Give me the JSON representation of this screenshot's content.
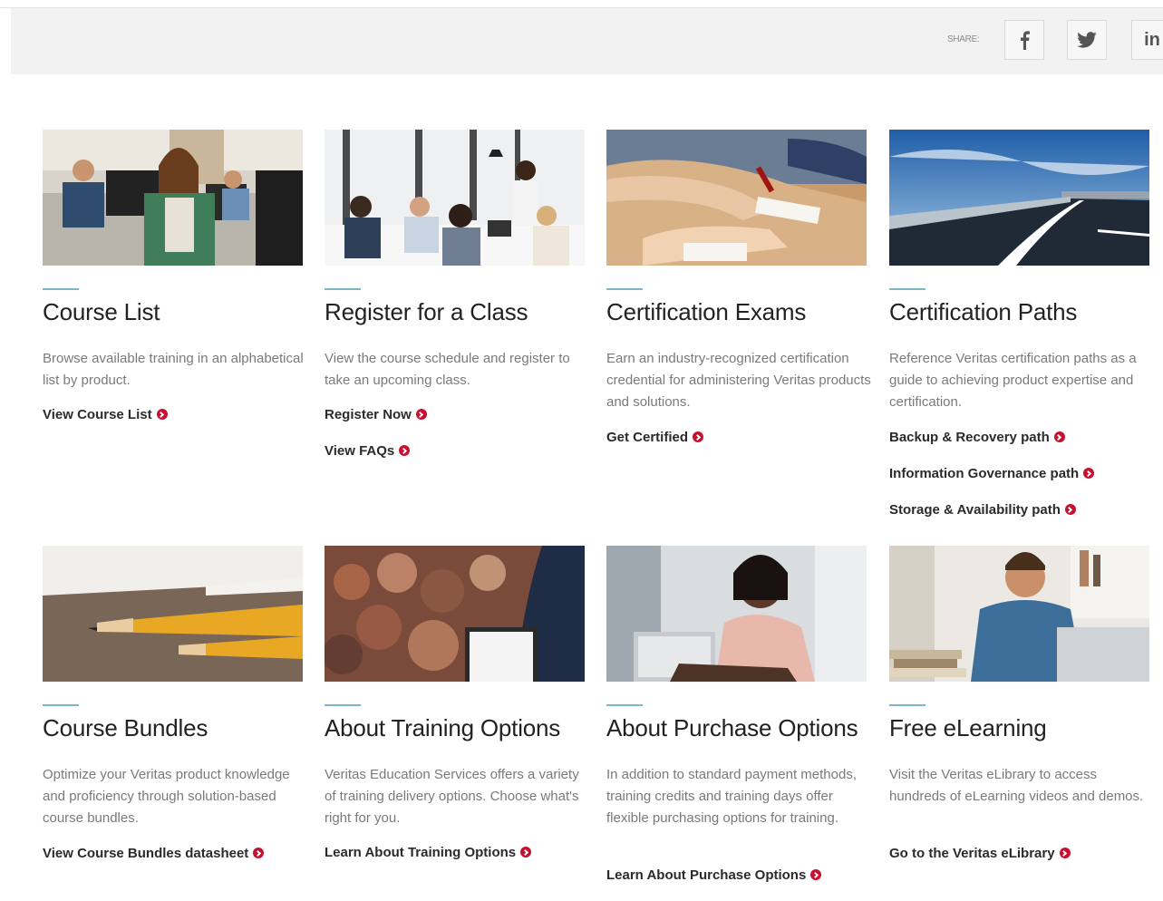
{
  "share": {
    "label": "SHARE:",
    "buttons": [
      {
        "icon": "facebook-icon",
        "glyph": "f"
      },
      {
        "icon": "twitter-icon",
        "glyph": ""
      },
      {
        "icon": "linkedin-icon",
        "glyph": "in"
      }
    ]
  },
  "colors": {
    "accent_line": "#7fb6c5",
    "arrow_red": "#c8102e",
    "share_bar": "#f2f2f2"
  },
  "cards": [
    {
      "title": "Course List",
      "description": "Browse available training in an alphabetical list by product.",
      "links": [
        "View Course List"
      ]
    },
    {
      "title": "Register for a Class",
      "description": "View the course schedule and register to take an upcoming class.",
      "links": [
        "Register Now",
        "View FAQs"
      ]
    },
    {
      "title": "Certification Exams",
      "description": "Earn an industry-recognized certification credential for administering Veritas products and solutions.",
      "links": [
        "Get Certified"
      ]
    },
    {
      "title": "Certification Paths",
      "description": "Reference Veritas certification paths as a guide to achieving product expertise and certification.",
      "links": [
        "Backup & Recovery path",
        "Information Governance path",
        "Storage & Availability path"
      ]
    },
    {
      "title": "Course Bundles",
      "description": "Optimize your Veritas product knowledge and proficiency through solution-based course bundles.",
      "links": [
        "View Course Bundles datasheet"
      ]
    },
    {
      "title": "About Training Options",
      "description": "Veritas Education Services offers a variety of training delivery options. Choose what's right for you.",
      "links": [
        "Learn About Training Options"
      ]
    },
    {
      "title": "About Purchase Options",
      "description": "In addition to standard payment methods, training credits and training days offer flexible purchasing options for training.",
      "links": [
        "Learn About Purchase Options"
      ]
    },
    {
      "title": "Free eLearning",
      "description": "Visit the Veritas eLibrary to access hundreds of eLearning videos and demos.",
      "links": [
        "Go to the Veritas eLibrary"
      ]
    }
  ]
}
